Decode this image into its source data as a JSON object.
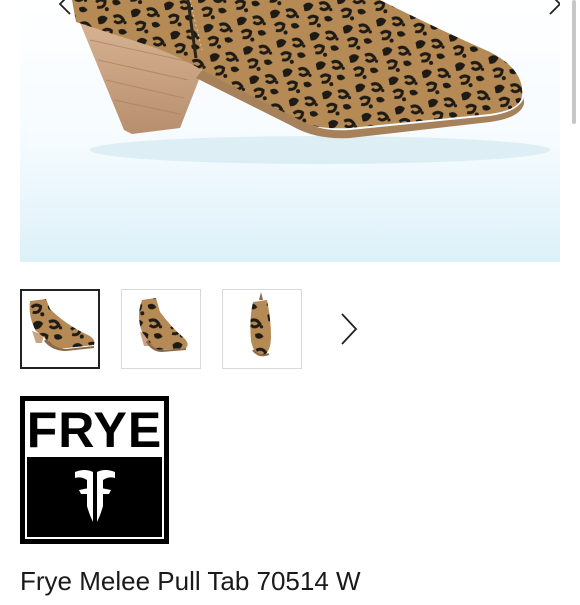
{
  "gallery": {
    "main_image": "frye-boot-leopard-side-view",
    "prev_icon": "chevron-left-icon",
    "next_icon": "chevron-right-icon",
    "thumbnails": [
      {
        "label": "boot-side-view",
        "selected": true
      },
      {
        "label": "boot-angled-view",
        "selected": false
      },
      {
        "label": "boot-front-view",
        "selected": false
      }
    ],
    "thumbnails_next_icon": "chevron-right-icon"
  },
  "brand": {
    "name": "FRYE",
    "logo_icon": "frye-double-f-icon"
  },
  "product": {
    "title": "Frye Melee Pull Tab 70514 W"
  },
  "colors": {
    "leopard_base": "#b58a55",
    "leopard_spot": "#1e1a14",
    "heel_wood": "#c9a383",
    "background_tint": "#dcf1f8"
  }
}
